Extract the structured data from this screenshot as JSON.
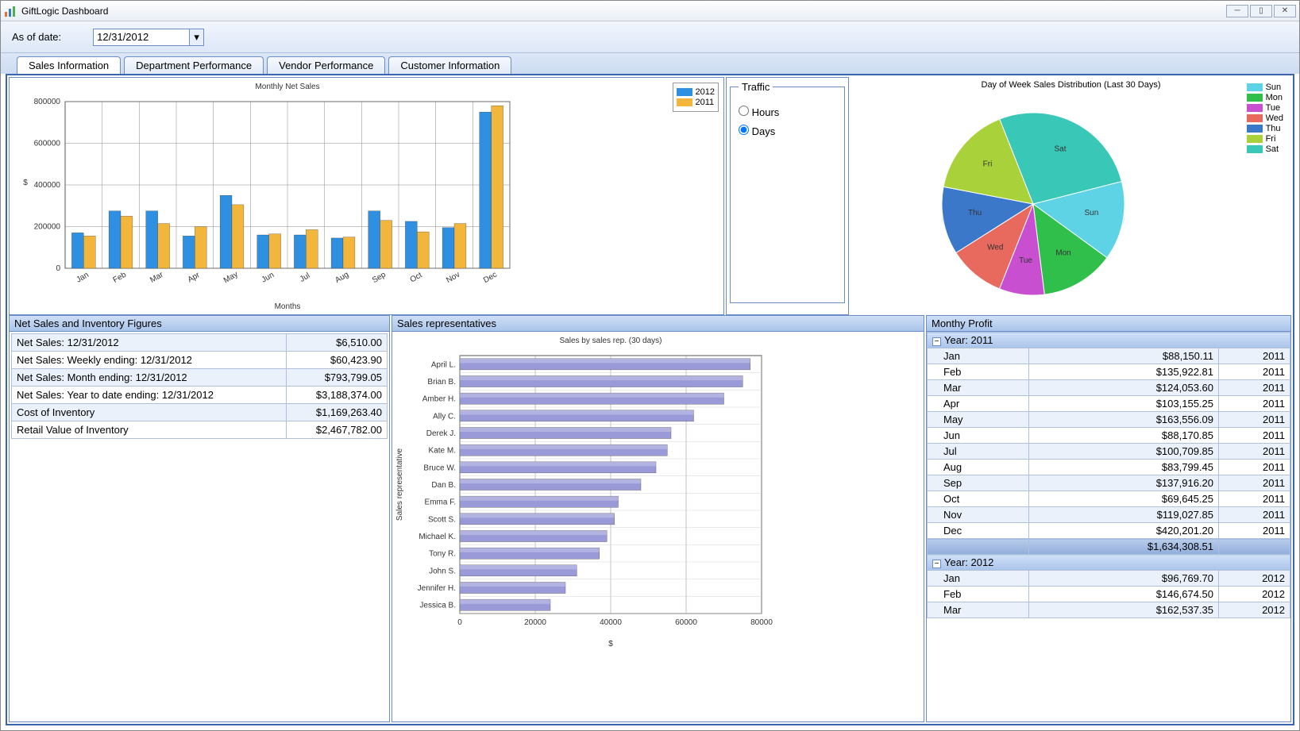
{
  "window_title": "GiftLogic Dashboard",
  "toolbar": {
    "asof_label": "As of date:",
    "asof_value": "12/31/2012"
  },
  "tabs": [
    "Sales Information",
    "Department Performance",
    "Vendor Performance",
    "Customer Information"
  ],
  "active_tab": 0,
  "traffic": {
    "legend": "Traffic",
    "opt_hours": "Hours",
    "opt_days": "Days",
    "selected": "Days"
  },
  "panels": {
    "figures_title": "Net Sales and Inventory Figures",
    "reps_title": "Sales representatives",
    "profit_title": "Monthy Profit"
  },
  "figures": [
    {
      "label": "Net Sales: 12/31/2012",
      "value": "$6,510.00"
    },
    {
      "label": "Net Sales: Weekly ending: 12/31/2012",
      "value": "$60,423.90"
    },
    {
      "label": "Net Sales: Month ending: 12/31/2012",
      "value": "$793,799.05"
    },
    {
      "label": "Net Sales: Year to date ending: 12/31/2012",
      "value": "$3,188,374.00"
    },
    {
      "label": "Cost of Inventory",
      "value": "$1,169,263.40"
    },
    {
      "label": "Retail Value of Inventory",
      "value": "$2,467,782.00"
    }
  ],
  "profit": {
    "groups": [
      {
        "year": "2011",
        "rows": [
          {
            "m": "Jan",
            "a": "$88,150.11",
            "y": "2011"
          },
          {
            "m": "Feb",
            "a": "$135,922.81",
            "y": "2011"
          },
          {
            "m": "Mar",
            "a": "$124,053.60",
            "y": "2011"
          },
          {
            "m": "Apr",
            "a": "$103,155.25",
            "y": "2011"
          },
          {
            "m": "May",
            "a": "$163,556.09",
            "y": "2011"
          },
          {
            "m": "Jun",
            "a": "$88,170.85",
            "y": "2011"
          },
          {
            "m": "Jul",
            "a": "$100,709.85",
            "y": "2011"
          },
          {
            "m": "Aug",
            "a": "$83,799.45",
            "y": "2011"
          },
          {
            "m": "Sep",
            "a": "$137,916.20",
            "y": "2011"
          },
          {
            "m": "Oct",
            "a": "$69,645.25",
            "y": "2011"
          },
          {
            "m": "Nov",
            "a": "$119,027.85",
            "y": "2011"
          },
          {
            "m": "Dec",
            "a": "$420,201.20",
            "y": "2011"
          }
        ],
        "total": "$1,634,308.51"
      },
      {
        "year": "2012",
        "rows": [
          {
            "m": "Jan",
            "a": "$96,769.70",
            "y": "2012"
          },
          {
            "m": "Feb",
            "a": "$146,674.50",
            "y": "2012"
          },
          {
            "m": "Mar",
            "a": "$162,537.35",
            "y": "2012"
          }
        ]
      }
    ]
  },
  "chart_data": [
    {
      "id": "monthly_net_sales",
      "type": "bar",
      "title": "Monthly Net Sales",
      "xlabel": "Months",
      "ylabel": "$",
      "ylim": [
        0,
        800000
      ],
      "categories": [
        "Jan",
        "Feb",
        "Mar",
        "Apr",
        "May",
        "Jun",
        "Jul",
        "Aug",
        "Sep",
        "Oct",
        "Nov",
        "Dec"
      ],
      "series": [
        {
          "name": "2012",
          "color": "#2f8fe0",
          "values": [
            170000,
            275000,
            275000,
            155000,
            350000,
            160000,
            160000,
            145000,
            275000,
            225000,
            195000,
            750000
          ]
        },
        {
          "name": "2011",
          "color": "#f2b63c",
          "values": [
            155000,
            250000,
            215000,
            200000,
            305000,
            165000,
            185000,
            150000,
            230000,
            175000,
            215000,
            780000
          ]
        }
      ]
    },
    {
      "id": "dow_pie",
      "type": "pie",
      "title": "Day of Week Sales Distribution (Last 30 Days)",
      "slices": [
        {
          "label": "Sun",
          "value": 14,
          "color": "#5fd3e6"
        },
        {
          "label": "Mon",
          "value": 13,
          "color": "#2fbf4a"
        },
        {
          "label": "Tue",
          "value": 8,
          "color": "#c94fd1"
        },
        {
          "label": "Wed",
          "value": 10,
          "color": "#e86a5e"
        },
        {
          "label": "Thu",
          "value": 12,
          "color": "#3b78c9"
        },
        {
          "label": "Fri",
          "value": 16,
          "color": "#a9d23a"
        },
        {
          "label": "Sat",
          "value": 27,
          "color": "#39c7b8"
        }
      ]
    },
    {
      "id": "sales_reps",
      "type": "bar",
      "orientation": "horizontal",
      "title": "Sales by sales rep. (30 days)",
      "xlabel": "$",
      "ylabel": "Sales representative",
      "xlim": [
        0,
        80000
      ],
      "categories": [
        "April L.",
        "Brian B.",
        "Amber H.",
        "Ally C.",
        "Derek J.",
        "Kate M.",
        "Bruce W.",
        "Dan B.",
        "Emma F.",
        "Scott S.",
        "Michael K.",
        "Tony R.",
        "John S.",
        "Jennifer H.",
        "Jessica B."
      ],
      "values": [
        77000,
        75000,
        70000,
        62000,
        56000,
        55000,
        52000,
        48000,
        42000,
        41000,
        39000,
        37000,
        31000,
        28000,
        24000
      ],
      "color": "#9a9ad9"
    }
  ]
}
